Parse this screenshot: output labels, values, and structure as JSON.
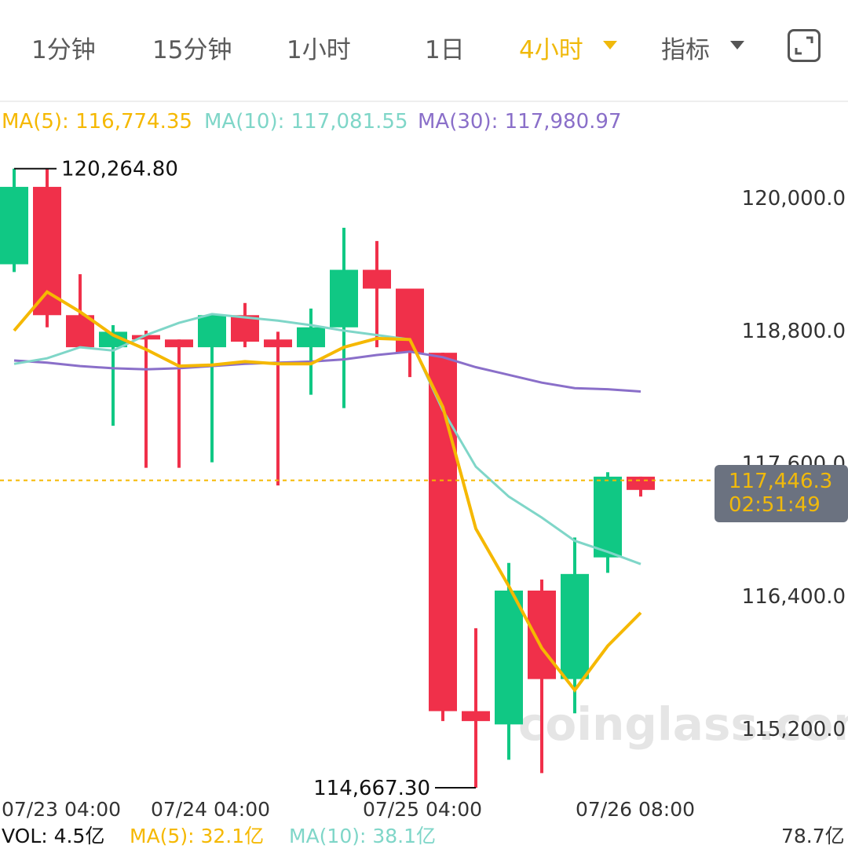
{
  "tabs": [
    {
      "label": "1分钟"
    },
    {
      "label": "15分钟"
    },
    {
      "label": "1小时"
    },
    {
      "label": "1日"
    },
    {
      "label": "4小时"
    },
    {
      "label": "指标"
    }
  ],
  "active_tab": "4小时",
  "icons": {
    "fullscreen": "expand-icon",
    "dropdown": "caret-down-icon"
  },
  "colors": {
    "up": "#10c884",
    "down": "#f0304a",
    "ma5": "#f5b800",
    "ma10": "#7fd6c8",
    "ma30": "#8a6fc9",
    "active": "#f0b90b"
  },
  "legend": {
    "ma5": "MA(5): 116,774.35",
    "ma10": "MA(10): 117,081.55",
    "ma30": "MA(30): 117,980.97"
  },
  "watermark": "coinglass.com",
  "current_price": {
    "value": "117,446.3",
    "countdown": "02:51:49",
    "price": 117446.3
  },
  "volume": {
    "vol": "VOL: 4.5亿",
    "ma5": "MA(5): 32.1亿",
    "ma10": "MA(10): 38.1亿",
    "right": "78.7亿"
  },
  "chart_data": {
    "type": "candlestick",
    "y_ticks": [
      "120,000.0",
      "118,800.0",
      "117,600.0",
      "116,400.0",
      "115,200.0"
    ],
    "y_tick_values": [
      120000,
      118800,
      117600,
      116400,
      115200
    ],
    "x_labels": [
      "07/23 04:00",
      "07/24 04:00",
      "07/25 04:00",
      "07/26 08:00"
    ],
    "high_label": "120,264.80",
    "high": 120264.8,
    "low_label": "114,667.30",
    "low": 114667.3,
    "candles": [
      {
        "o": 119400,
        "c": 120100,
        "h": 120264.8,
        "l": 119330
      },
      {
        "o": 120100,
        "c": 118940,
        "h": 120260,
        "l": 118830
      },
      {
        "o": 118940,
        "c": 118650,
        "h": 119310,
        "l": 118650
      },
      {
        "o": 118650,
        "c": 118790,
        "h": 118850,
        "l": 117940
      },
      {
        "o": 118760,
        "c": 118720,
        "h": 118800,
        "l": 117560
      },
      {
        "o": 118720,
        "c": 118650,
        "h": 118720,
        "l": 117560
      },
      {
        "o": 118650,
        "c": 118940,
        "h": 118940,
        "l": 117610
      },
      {
        "o": 118940,
        "c": 118700,
        "h": 119050,
        "l": 118650
      },
      {
        "o": 118720,
        "c": 118650,
        "h": 118790,
        "l": 117400
      },
      {
        "o": 118650,
        "c": 118830,
        "h": 119000,
        "l": 118220
      },
      {
        "o": 118830,
        "c": 119350,
        "h": 119730,
        "l": 118100
      },
      {
        "o": 119350,
        "c": 119180,
        "h": 119610,
        "l": 118650
      },
      {
        "o": 119180,
        "c": 118600,
        "h": 119180,
        "l": 118380
      },
      {
        "o": 118600,
        "c": 115360,
        "h": 118600,
        "l": 115270
      },
      {
        "o": 115360,
        "c": 115270,
        "h": 116110,
        "l": 114667.3
      },
      {
        "o": 115240,
        "c": 116450,
        "h": 116700,
        "l": 114920
      },
      {
        "o": 116450,
        "c": 115650,
        "h": 116550,
        "l": 114800
      },
      {
        "o": 115650,
        "c": 116600,
        "h": 116930,
        "l": 115340
      },
      {
        "o": 116750,
        "c": 117480,
        "h": 117520,
        "l": 116610
      },
      {
        "o": 117480,
        "c": 117360,
        "h": 117480,
        "l": 117300
      }
    ],
    "ma5": [
      118800,
      119150,
      118970,
      118760,
      118630,
      118480,
      118490,
      118520,
      118500,
      118500,
      118650,
      118730,
      118720,
      118110,
      117010,
      116490,
      115930,
      115550,
      115950,
      116250
    ],
    "ma10": [
      118500,
      118550,
      118650,
      118620,
      118760,
      118870,
      118950,
      118920,
      118890,
      118850,
      118800,
      118760,
      118720,
      118080,
      117570,
      117300,
      117110,
      116900,
      116800,
      116690
    ],
    "ma30": [
      118530,
      118510,
      118480,
      118460,
      118450,
      118460,
      118480,
      118500,
      118510,
      118520,
      118540,
      118580,
      118610,
      118560,
      118470,
      118400,
      118330,
      118280,
      118270,
      118250
    ]
  }
}
